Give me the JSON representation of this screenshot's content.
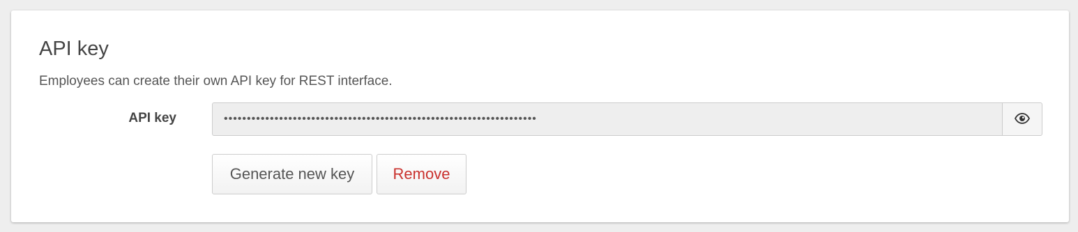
{
  "section": {
    "title": "API key",
    "description": "Employees can create their own API key for REST interface."
  },
  "api_key_field": {
    "label": "API key",
    "value": "••••••••••••••••••••••••••••••••••••••••••••••••••••••••••••••••••••",
    "toggle_icon": "eye-icon"
  },
  "actions": {
    "generate_label": "Generate new key",
    "remove_label": "Remove"
  },
  "colors": {
    "remove_text": "#c9302c",
    "input_background": "#eeeeee",
    "page_background": "#eeeeee"
  }
}
